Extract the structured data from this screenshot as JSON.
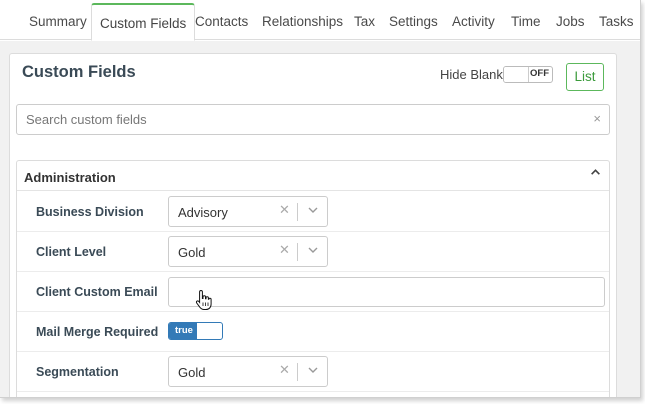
{
  "tabs": [
    {
      "label": "Summary"
    },
    {
      "label": "Custom Fields"
    },
    {
      "label": "Contacts"
    },
    {
      "label": "Relationships"
    },
    {
      "label": "Tax"
    },
    {
      "label": "Settings"
    },
    {
      "label": "Activity"
    },
    {
      "label": "Time"
    },
    {
      "label": "Jobs"
    },
    {
      "label": "Tasks"
    }
  ],
  "active_tab": "Custom Fields",
  "panel": {
    "title": "Custom Fields",
    "hide_blank_label": "Hide Blank",
    "hide_blank_toggle": "OFF",
    "list_button": "List"
  },
  "search": {
    "placeholder": "Search custom fields",
    "value": "",
    "clear_icon": "×"
  },
  "section": {
    "title": "Administration",
    "collapse_icon": "chevron-up-icon",
    "fields": [
      {
        "label": "Business Division",
        "type": "select",
        "value": "Advisory"
      },
      {
        "label": "Client Level",
        "type": "select",
        "value": "Gold"
      },
      {
        "label": "Client Custom Email",
        "type": "text",
        "value": ""
      },
      {
        "label": "Mail Merge Required",
        "type": "toggle",
        "value": "true"
      },
      {
        "label": "Segmentation",
        "type": "select",
        "value": "Gold"
      }
    ]
  },
  "colors": {
    "active_tab_accent": "#5cb85c",
    "list_button": "#5cb85c",
    "toggle_on": "#337ab7",
    "label_text": "#3a4a56"
  }
}
